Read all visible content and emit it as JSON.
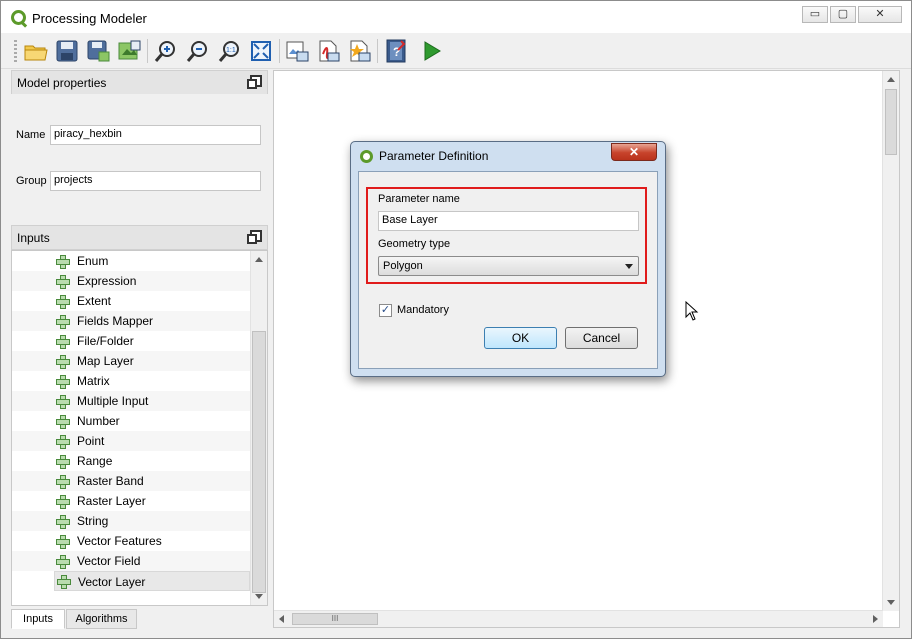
{
  "window": {
    "title": "Processing Modeler",
    "controls": {
      "minimize": "▭",
      "maximize": "▢",
      "close": "✕"
    }
  },
  "toolbar": {
    "buttons": [
      {
        "name": "open-model",
        "icon": "folder-icon"
      },
      {
        "name": "save-model",
        "icon": "save-icon"
      },
      {
        "name": "save-as",
        "icon": "save-as-icon"
      },
      {
        "name": "save-to-project",
        "icon": "save-project-icon"
      },
      {
        "name": "zoom-in",
        "icon": "zoom-in-icon"
      },
      {
        "name": "zoom-out",
        "icon": "zoom-out-icon"
      },
      {
        "name": "zoom-actual",
        "icon": "zoom-actual-icon"
      },
      {
        "name": "zoom-full",
        "icon": "zoom-full-icon"
      },
      {
        "name": "export-image",
        "icon": "export-image-icon"
      },
      {
        "name": "export-pdf",
        "icon": "export-pdf-icon"
      },
      {
        "name": "export-svg",
        "icon": "export-svg-icon"
      },
      {
        "name": "edit-help",
        "icon": "help-icon"
      },
      {
        "name": "run-model",
        "icon": "run-icon"
      }
    ]
  },
  "model_properties": {
    "header": "Model properties",
    "name_label": "Name",
    "name_value": "piracy_hexbin",
    "group_label": "Group",
    "group_value": "projects"
  },
  "inputs": {
    "header": "Inputs",
    "items": [
      "Enum",
      "Expression",
      "Extent",
      "Fields Mapper",
      "File/Folder",
      "Map Layer",
      "Matrix",
      "Multiple Input",
      "Number",
      "Point",
      "Range",
      "Raster Band",
      "Raster Layer",
      "String",
      "Vector Features",
      "Vector Field",
      "Vector Layer"
    ],
    "selected": "Vector Layer"
  },
  "tabs": {
    "inputs": "Inputs",
    "algorithms": "Algorithms"
  },
  "canvas": {
    "hscroll_grip": "III"
  },
  "dialog": {
    "title": "Parameter Definition",
    "close": "✕",
    "param_name_label": "Parameter name",
    "param_name_value": "Base Layer",
    "geometry_label": "Geometry type",
    "geometry_value": "Polygon",
    "mandatory_label": "Mandatory",
    "mandatory_checked": "✓",
    "ok_label": "OK",
    "cancel_label": "Cancel"
  },
  "colors": {
    "highlight": "#e01b1b",
    "run_green": "#2f9a2f",
    "qgis_green": "#5c9a2a"
  }
}
